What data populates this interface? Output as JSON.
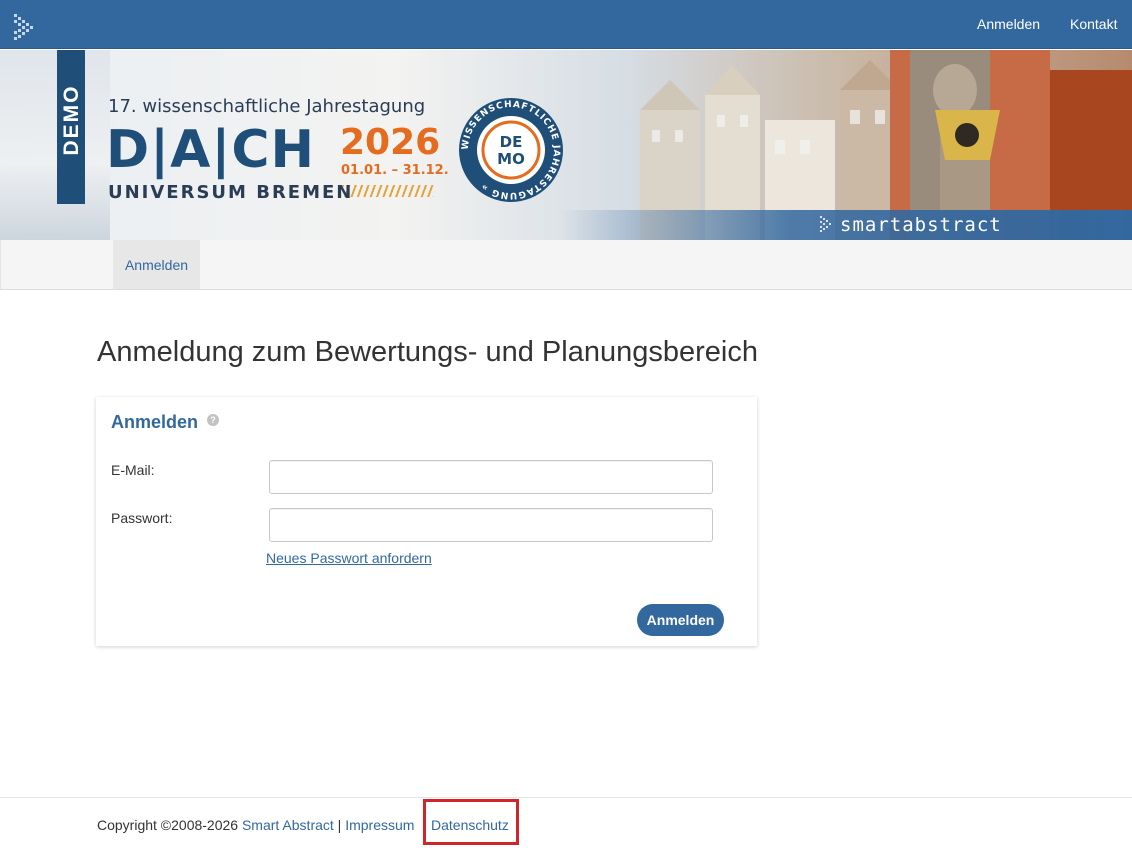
{
  "topbar": {
    "nav": {
      "login": "Anmelden",
      "contact": "Kontakt"
    }
  },
  "banner": {
    "demo_label": "DEMO",
    "subtitle": "17. wissenschaftliche Jahrestagung",
    "event_name": "D|A|CH",
    "year": "2026",
    "dates": "01.01. – 31.12.",
    "venue": "UNIVERSUM BREMEN",
    "seal_center": [
      "DE",
      "MO"
    ],
    "seal_ring": "WISSENSCHAFTLICHE JAHRESTAGUNG »",
    "brand": "smartabstract",
    "colors": {
      "primary": "#33689f",
      "dark": "#1f4f79",
      "accent": "#e56b1f"
    }
  },
  "subnav": {
    "active_tab": "Anmelden"
  },
  "main": {
    "title": "Anmeldung zum Bewertungs- und Planungsbereich",
    "login_panel": {
      "heading": "Anmelden",
      "help_icon": "?",
      "email_label": "E-Mail:",
      "email_value": "",
      "password_label": "Passwort:",
      "password_value": "",
      "forgot_link": "Neues Passwort anfordern",
      "submit": "Anmelden"
    }
  },
  "footer": {
    "copyright": "Copyright ©2008-2026 ",
    "company_link": "Smart Abstract",
    "separator": " | ",
    "imprint_link": "Impressum",
    "privacy_link": "Datenschutz",
    "highlight_color": "#d1242b"
  }
}
